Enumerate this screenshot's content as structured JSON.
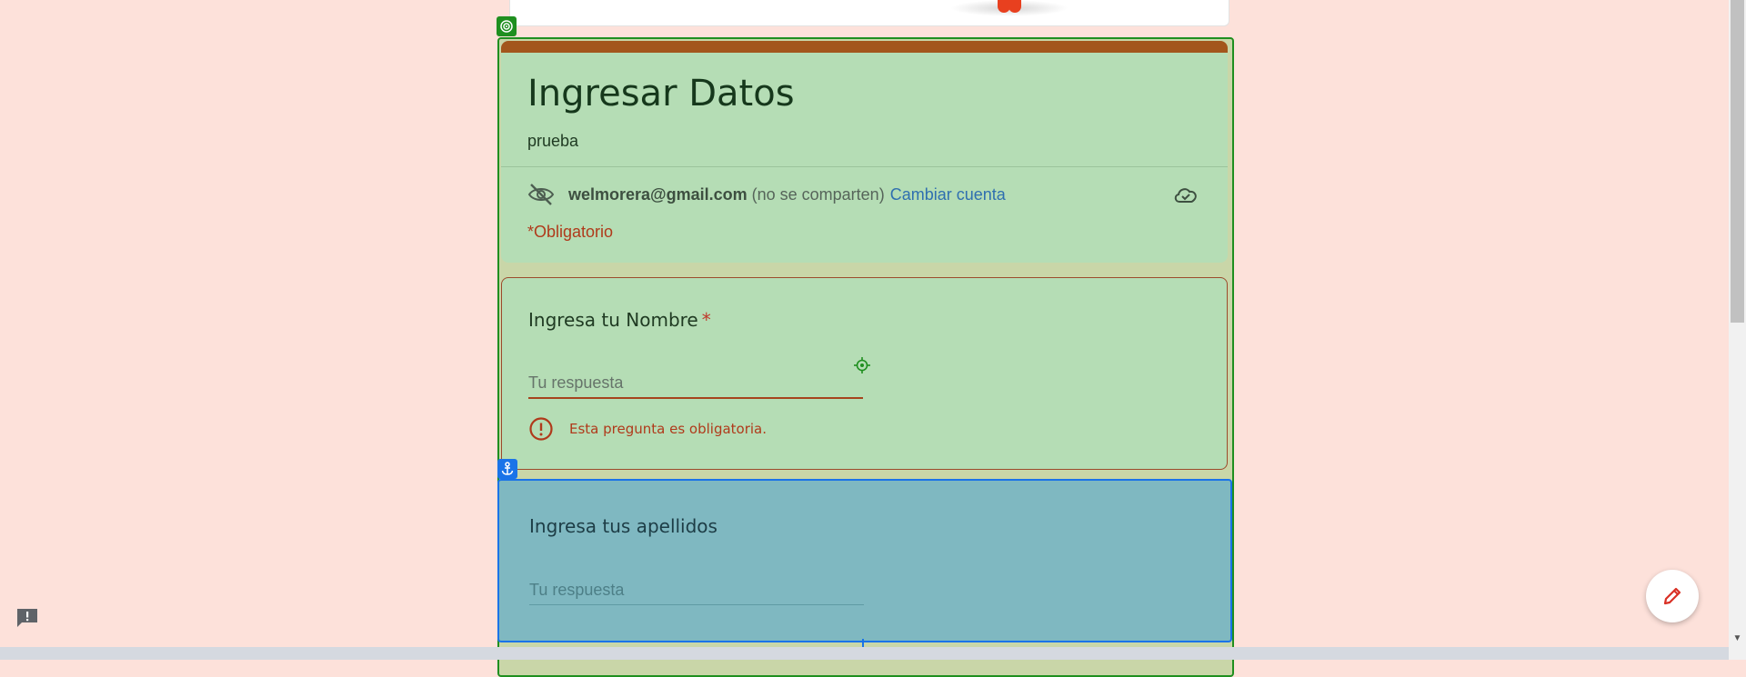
{
  "form": {
    "title": "Ingresar Datos",
    "description": "prueba",
    "account_email": "welmorera@gmail.com",
    "account_note": "(no se comparten)",
    "switch_account": "Cambiar cuenta",
    "required_note": "*Obligatorio"
  },
  "questions": [
    {
      "title": "Ingresa tu Nombre",
      "required_mark": "*",
      "placeholder": "Tu respuesta",
      "error": "Esta pregunta es obligatoria."
    },
    {
      "title": "Ingresa tus apellidos",
      "placeholder": "Tu respuesta"
    }
  ],
  "icons": {
    "visibility": "eye-off-icon",
    "cloud": "cloud-check-icon",
    "error": "error-icon",
    "feedback": "feedback-icon",
    "edit": "pencil-icon",
    "target": "target-icon",
    "anchor": "anchor-icon"
  },
  "colors": {
    "page_background": "#fde1da",
    "header_accent": "#a3561c",
    "card_background": "#b5ddb5",
    "error": "#b03a1b",
    "selection_green": "#1f8f1f",
    "selection_blue": "#1a73e8",
    "link": "#2f6fb0"
  }
}
